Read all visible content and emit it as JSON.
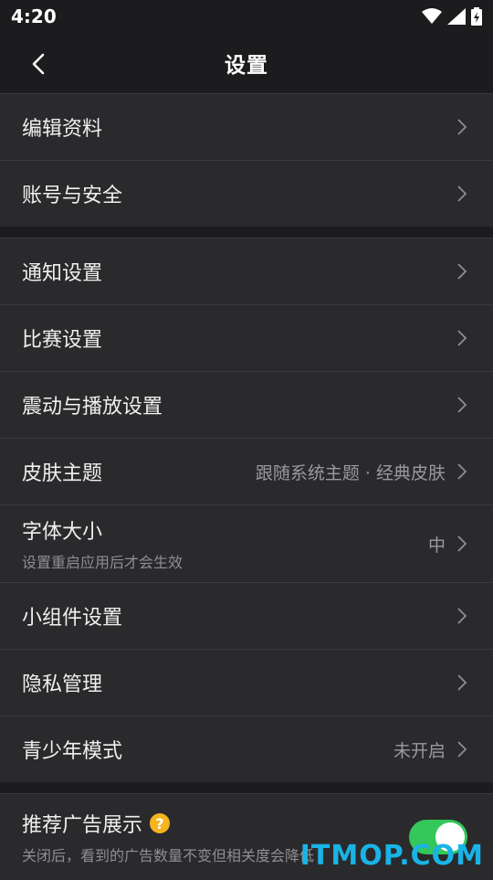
{
  "status": {
    "time": "4:20"
  },
  "header": {
    "title": "设置"
  },
  "groups": [
    {
      "items": [
        {
          "label": "编辑资料"
        },
        {
          "label": "账号与安全"
        }
      ]
    },
    {
      "items": [
        {
          "label": "通知设置"
        },
        {
          "label": "比赛设置"
        },
        {
          "label": "震动与播放设置"
        },
        {
          "label": "皮肤主题",
          "value": "跟随系统主题 · 经典皮肤"
        },
        {
          "label": "字体大小",
          "sub": "设置重启应用后才会生效",
          "value": "中"
        },
        {
          "label": "小组件设置"
        },
        {
          "label": "隐私管理"
        },
        {
          "label": "青少年模式",
          "value": "未开启"
        }
      ]
    }
  ],
  "ad": {
    "label": "推荐广告展示",
    "help": "?",
    "sub": "关闭后，看到的广告数量不变但相关度会降低",
    "toggle_on": true
  },
  "watermark": "ITMOP.COM",
  "colors": {
    "toggle": "#34c759",
    "help": "#f5b41e",
    "background": "#1c1c1e",
    "row": "#2a2a2c"
  }
}
